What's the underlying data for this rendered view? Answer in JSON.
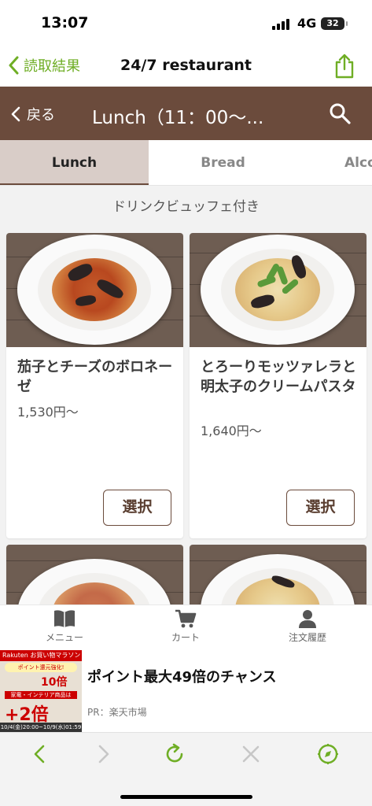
{
  "status": {
    "time": "13:07",
    "network": "4G",
    "battery": "32"
  },
  "browser": {
    "back_label": "読取結果",
    "title": "24/7 restaurant"
  },
  "header": {
    "back_label": "戻る",
    "title": "Lunch（11：00〜..."
  },
  "tabs": [
    {
      "label": "Lunch",
      "active": true
    },
    {
      "label": "Bread",
      "active": false
    },
    {
      "label": "Alco",
      "active": false
    }
  ],
  "section": {
    "subtitle": "ドリンクビュッフェ付き"
  },
  "menu_items": [
    {
      "name": "茄子とチーズのボロネーゼ",
      "price": "1,530円〜",
      "select_label": "選択"
    },
    {
      "name": "とろーりモッツァレラと明太子のクリームパスタ",
      "price": "1,640円〜",
      "select_label": "選択"
    }
  ],
  "bottom_nav": [
    {
      "label": "メニュー",
      "icon": "book-icon"
    },
    {
      "label": "カート",
      "icon": "cart-icon"
    },
    {
      "label": "注文履歴",
      "icon": "person-icon"
    }
  ],
  "ad": {
    "headline": "ポイント最大49倍のチャンス",
    "source": "PR：楽天市場",
    "image_texts": {
      "banner": "Rakuten お買い物マラソン",
      "campaign": "ポイント還元強化!",
      "multiplier_1": "10倍",
      "category": "家電・インテリア商品は",
      "multiplier_2": "+2倍",
      "period": "10/4(金)20:00~10/9(水)01:59"
    }
  },
  "colors": {
    "header_brown": "#6b4b3c",
    "accent_green": "#6fae25",
    "active_tab_bg": "#d9cdc8"
  }
}
